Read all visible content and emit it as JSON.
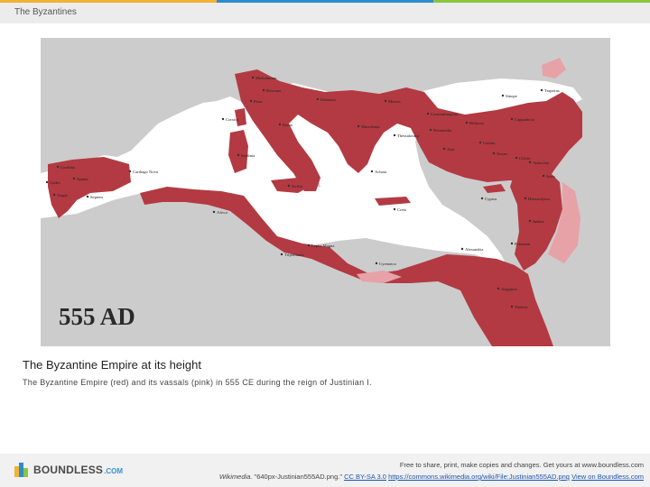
{
  "header": {
    "title": "The Byzantines",
    "bar_colors": [
      "#f2b233",
      "#2f8ccc",
      "#8cc63e"
    ]
  },
  "map": {
    "year_label": "555 AD",
    "colors": {
      "sea": "#ffffff",
      "land": "#cccccc",
      "empire": "#b33a42",
      "vassal": "#e7a2a8"
    },
    "places": [
      "Mediolanum",
      "Ravenna",
      "Pisae",
      "Roma",
      "Dalmatia",
      "Moesia",
      "Sinope",
      "Trapezus",
      "Macedonia",
      "Bithynia",
      "Cappadocia",
      "Corsica",
      "Sardinia",
      "Sicilia",
      "Achaia",
      "Asia",
      "Galatia",
      "Cilicia",
      "Syria",
      "Cyprus",
      "Creta",
      "Spania",
      "Carthago Nova",
      "Africa",
      "Tripolitania",
      "Cyrenaica",
      "Aegyptus",
      "Alexandria",
      "Judaea",
      "Thebais",
      "Cordoba",
      "Gades",
      "Septem",
      "Tingis",
      "Leptis Magna",
      "Hierosolyma",
      "Nicomedia",
      "Thessalonica",
      "Constantinopolis",
      "Tarsus",
      "Antiochia",
      "Pelusium"
    ]
  },
  "caption": {
    "title": "The Byzantine Empire at its height",
    "description": "The Byzantine Empire (red) and its vassals (pink) in 555 CE during the reign of Justinian I."
  },
  "footer": {
    "logo_text": "BOUNDLESS",
    "logo_suffix": ".COM",
    "free_text": "Free to share, print, make copies and changes. Get yours at www.boundless.com",
    "source": "Wikimedia.",
    "file_name": "\"640px-Justinian555AD.png.\"",
    "license": "CC BY-SA 3.0",
    "url": "https://commons.wikimedia.org/wiki/File:Justinian555AD.png",
    "view_link": "View on Boundless.com"
  }
}
